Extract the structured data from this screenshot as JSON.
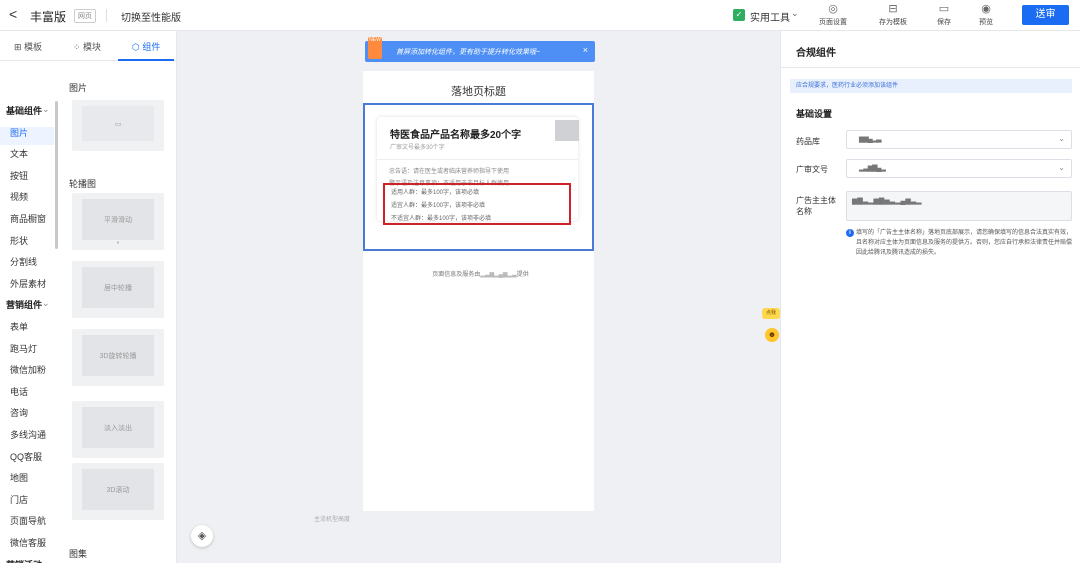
{
  "header": {
    "back_glyph": "<",
    "title": "丰富版",
    "tag": "网页",
    "switch_label": "切换至性能版",
    "tools_label": "实用工具",
    "actions": [
      {
        "icon": "page-settings-icon",
        "label": "页面设置"
      },
      {
        "icon": "template-icon",
        "label": "存为模板"
      },
      {
        "icon": "save-icon",
        "label": "保存"
      },
      {
        "icon": "preview-icon",
        "label": "预览"
      }
    ],
    "submit_label": "送审"
  },
  "left_panel": {
    "tabs": [
      "模板",
      "模块",
      "组件"
    ],
    "active_tab": "组件",
    "nav": [
      {
        "label": "基础组件",
        "group": true
      },
      {
        "label": "图片",
        "active": true
      },
      {
        "label": "文本"
      },
      {
        "label": "按钮"
      },
      {
        "label": "视频"
      },
      {
        "label": "商品橱窗"
      },
      {
        "label": "形状"
      },
      {
        "label": "分割线"
      },
      {
        "label": "外层素材"
      },
      {
        "label": "营销组件",
        "group": true
      },
      {
        "label": "表单"
      },
      {
        "label": "跑马灯"
      },
      {
        "label": "微信加粉"
      },
      {
        "label": "电话"
      },
      {
        "label": "咨询"
      },
      {
        "label": "多线沟通"
      },
      {
        "label": "QQ客服"
      },
      {
        "label": "地图"
      },
      {
        "label": "门店"
      },
      {
        "label": "页面导航"
      },
      {
        "label": "微信客服"
      },
      {
        "label": "营销活动",
        "group": true
      }
    ],
    "sections": {
      "image": "图片",
      "carousel": "轮播图",
      "gallery": "图集"
    },
    "carousel_cards": [
      "平滑滑动",
      "居中轮播",
      "3D旋转轮播",
      "淡入淡出",
      "3D滚动"
    ]
  },
  "canvas": {
    "banner_badge": "NEW",
    "banner_text": "首屏添加转化组件，更有助于提升转化效果哦~",
    "page_title": "落地页标题",
    "product": {
      "name": "特医食品产品名称最多20个字",
      "subtitle": "广审文号最多30个字",
      "notes": [
        "忠告语：请在医生或者临床营养师指导下使用",
        "警示语及注意事项：不适用于非目标人群使用"
      ],
      "boxed_lines": [
        "适用人群：最多100字，该项必填",
        "适宜人群：最多100字，该项非必填",
        "不适宜人群：最多100字，该项非必填"
      ]
    },
    "footer_prefix": "页面信息及服务由",
    "footer_suffix": "提供",
    "bottom_label": "主流机型高度",
    "help_label": "点我"
  },
  "right_panel": {
    "title": "合规组件",
    "notice": "应合规要求，医药行业必须添加该组件",
    "section": "基础设置",
    "drug_label": "药品库",
    "drug_value": "▆▆▄▂▃",
    "approval_label": "广审文号",
    "approval_value": "▂▃▆▇▄▂",
    "advertiser_label": "广告主主体名称",
    "advertiser_value": "▆▇▃▂▆▇▅▃▂▄▆▃▂",
    "info": "填写的「广告主主体名称」落地页底部展示，请您确保填写的信息合法真实有效，且名称对应主体为页面信息及服务的提供方。否则，您应自行承担法律责任并赔偿因此给腾讯及腾讯造成的损失。"
  }
}
